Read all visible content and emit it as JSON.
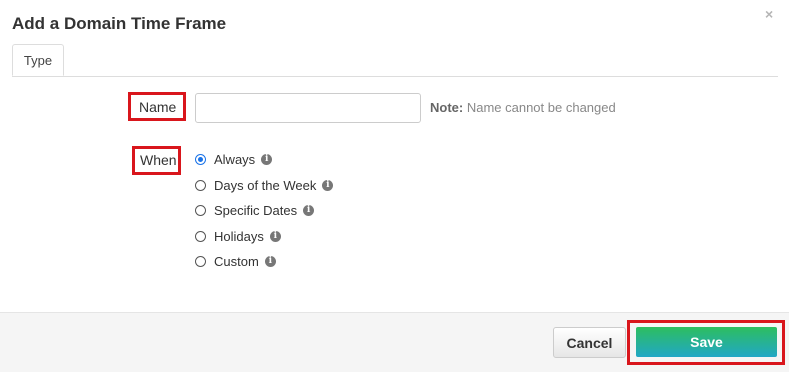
{
  "dialog": {
    "title": "Add a Domain Time Frame",
    "close_glyph": "×"
  },
  "tabs": [
    {
      "label": "Type",
      "active": true
    }
  ],
  "form": {
    "name_label": "Name",
    "name_value": "",
    "note_bold": "Note:",
    "note_text": " Name cannot be changed",
    "when_label": "When",
    "options": [
      {
        "label": "Always",
        "checked": true,
        "icon": "info-icon"
      },
      {
        "label": "Days of the Week",
        "checked": false,
        "icon": "info-icon"
      },
      {
        "label": "Specific Dates",
        "checked": false,
        "icon": "info-icon"
      },
      {
        "label": "Holidays",
        "checked": false,
        "icon": "info-icon"
      },
      {
        "label": "Custom",
        "checked": false,
        "icon": "info-icon"
      }
    ]
  },
  "footer": {
    "cancel_label": "Cancel",
    "save_label": "Save"
  },
  "colors": {
    "highlight": "#d9161c",
    "radio_accent": "#1a73e8",
    "save_gradient_top": "#2dbe5f",
    "save_gradient_bottom": "#21a7c6"
  }
}
